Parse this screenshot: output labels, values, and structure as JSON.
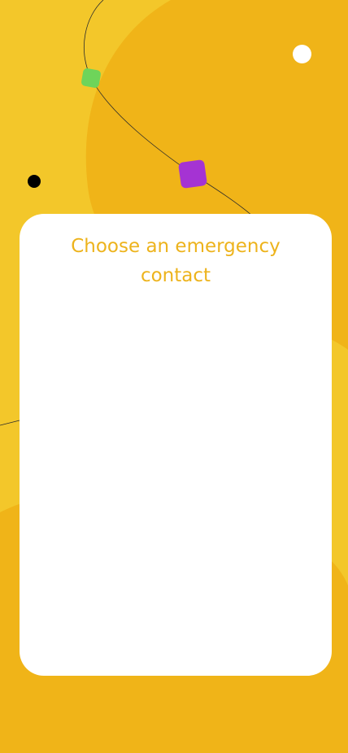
{
  "screen": {
    "title": "Choose an emergency contact"
  },
  "colors": {
    "background_light": "#f3c72a",
    "background_dark": "#f0b418",
    "card": "#ffffff",
    "title_text": "#edb31c",
    "accent_green": "#6ed45a",
    "accent_purple": "#a533d3",
    "dot_black": "#000000",
    "dot_white": "#ffffff",
    "path_line": "#2b2b2b"
  },
  "decorations": {
    "icons": [
      "green-square-icon",
      "purple-square-icon",
      "black-dot-icon",
      "white-dot-icon"
    ]
  }
}
